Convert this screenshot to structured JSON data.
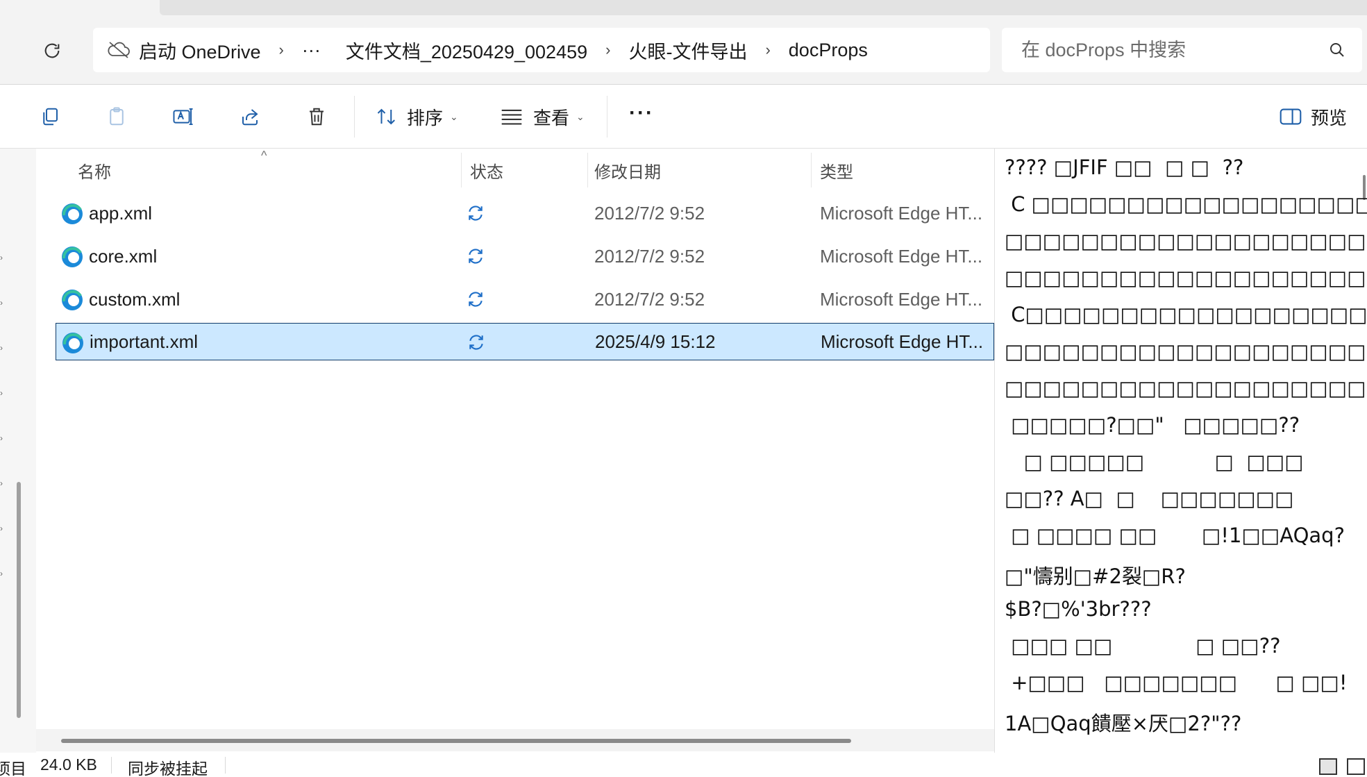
{
  "address_bar": {
    "crumbs": [
      "启动 OneDrive",
      "···",
      "文件文档_20250429_002459",
      "火眼-文件导出",
      "docProps"
    ],
    "search_placeholder": "在 docProps 中搜索"
  },
  "command_bar": {
    "sort_label": "排序",
    "view_label": "查看",
    "more_label": "···",
    "preview_label": "预览"
  },
  "file_list": {
    "columns": [
      "名称",
      "状态",
      "修改日期",
      "类型"
    ],
    "rows": [
      {
        "name": "app.xml",
        "date": "2012/7/2 9:52",
        "type": "Microsoft Edge HT..."
      },
      {
        "name": "core.xml",
        "date": "2012/7/2 9:52",
        "type": "Microsoft Edge HT..."
      },
      {
        "name": "custom.xml",
        "date": "2012/7/2 9:52",
        "type": "Microsoft Edge HT..."
      },
      {
        "name": "important.xml",
        "date": "2025/4/9 15:12",
        "type": "Microsoft Edge HT...",
        "selected": true
      }
    ]
  },
  "preview": {
    "lines": [
      "???? □JFIF □□  □ □  ??",
      " C □□□□□□□□□□□□□□□□□□□□□□",
      "□□□□□□□□□□□□□□□□□□□□□□□□□",
      "□□□□□□□□□□□□□□□□□□□□□??",
      " C□□□□□□□□□□□□□□□□□□□□□□□",
      "□□□□□□□□□□□□□□□□□□□□□□□□□",
      "□□□□□□□□□□□□□□□□□□□□□??",
      " □□□□□?□□\"   □□□□□??",
      "   □ □□□□□           □  □□□",
      "□□?? A□  □    □□□□□□□",
      " □ □□□□ □□       □!1□□AQaq?",
      "□\"懤别□#2裂□R?",
      "$B?□%'3br???",
      " □□□ □□             □ □□??",
      " +□□□   □□□□□□□      □ □□!",
      "1A□Qaq饋壓×厌□2?\"??"
    ]
  },
  "status_bar": {
    "items_label": "项目",
    "size": "24.0 KB",
    "sync_status": "同步被挂起"
  },
  "colors": {
    "selection": "#cce8ff",
    "accent": "#0067c0"
  }
}
